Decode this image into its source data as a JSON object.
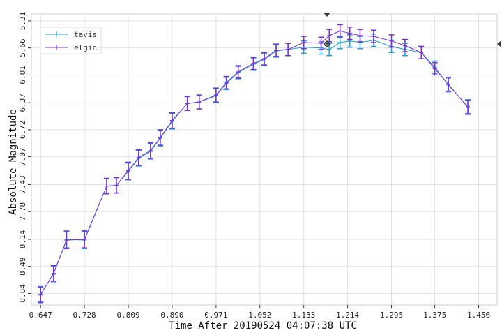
{
  "chart_data": {
    "type": "line",
    "xlabel": "Time After 20190524 04:07:38 UTC",
    "ylabel": "Absolute Magnitude",
    "xlim": [
      0.63,
      1.49
    ],
    "ylim": [
      8.99,
      5.22
    ],
    "y_axis_inverted": true,
    "grid": true,
    "legend_position": "top-left",
    "error_bars": true,
    "x_ticks": [
      "0.647",
      "0.728",
      "0.809",
      "0.890",
      "0.971",
      "1.052",
      "1.133",
      "1.214",
      "1.295",
      "1.375",
      "1.456"
    ],
    "y_ticks": [
      "5.31",
      "5.66",
      "6.01",
      "6.37",
      "6.72",
      "7.07",
      "7.43",
      "7.78",
      "8.14",
      "8.49",
      "8.84"
    ],
    "series": [
      {
        "name": "tavis",
        "color": "#1f9fd6",
        "x": [
          0.647,
          0.671,
          0.695,
          0.728,
          0.769,
          0.787,
          0.809,
          0.828,
          0.85,
          0.868,
          0.89,
          0.918,
          0.94,
          0.971,
          0.99,
          1.012,
          1.04,
          1.06,
          1.082,
          1.104,
          1.133,
          1.165,
          1.18,
          1.2,
          1.218,
          1.237,
          1.262,
          1.295,
          1.32,
          1.35,
          1.375,
          1.4,
          1.436
        ],
        "y": [
          8.85,
          8.59,
          8.14,
          8.15,
          7.45,
          7.44,
          7.26,
          7.09,
          7.0,
          6.83,
          6.61,
          6.38,
          6.36,
          6.28,
          6.12,
          5.98,
          5.87,
          5.81,
          5.7,
          5.68,
          5.65,
          5.66,
          5.68,
          5.59,
          5.57,
          5.59,
          5.56,
          5.64,
          5.68,
          5.72,
          5.91,
          6.14,
          6.42
        ],
        "err": [
          0.1,
          0.1,
          0.11,
          0.11,
          0.1,
          0.1,
          0.11,
          0.1,
          0.1,
          0.1,
          0.1,
          0.09,
          0.09,
          0.09,
          0.08,
          0.08,
          0.08,
          0.08,
          0.08,
          0.08,
          0.08,
          0.08,
          0.08,
          0.08,
          0.08,
          0.08,
          0.08,
          0.08,
          0.08,
          0.08,
          0.08,
          0.09,
          0.09
        ]
      },
      {
        "name": "elgin",
        "color": "#7a2fd6",
        "x": [
          0.647,
          0.671,
          0.695,
          0.728,
          0.769,
          0.787,
          0.809,
          0.828,
          0.85,
          0.868,
          0.89,
          0.918,
          0.94,
          0.971,
          0.99,
          1.012,
          1.04,
          1.06,
          1.082,
          1.104,
          1.133,
          1.165,
          1.18,
          1.2,
          1.218,
          1.237,
          1.262,
          1.295,
          1.32,
          1.35,
          1.375,
          1.4,
          1.436
        ],
        "y": [
          8.86,
          8.58,
          8.15,
          8.14,
          7.45,
          7.44,
          7.25,
          7.08,
          6.99,
          6.82,
          6.6,
          6.38,
          6.36,
          6.27,
          6.11,
          5.97,
          5.86,
          5.8,
          5.69,
          5.68,
          5.59,
          5.6,
          5.5,
          5.44,
          5.47,
          5.5,
          5.51,
          5.57,
          5.63,
          5.72,
          5.93,
          6.13,
          6.43
        ],
        "err": [
          0.1,
          0.1,
          0.11,
          0.11,
          0.1,
          0.1,
          0.11,
          0.1,
          0.1,
          0.1,
          0.1,
          0.09,
          0.09,
          0.09,
          0.08,
          0.08,
          0.08,
          0.08,
          0.08,
          0.08,
          0.08,
          0.08,
          0.08,
          0.08,
          0.08,
          0.08,
          0.08,
          0.08,
          0.08,
          0.08,
          0.08,
          0.09,
          0.09
        ]
      }
    ]
  }
}
